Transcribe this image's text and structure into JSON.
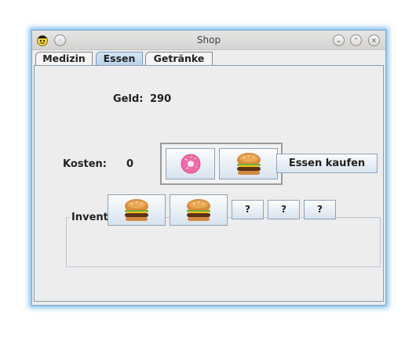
{
  "window": {
    "title": "Shop",
    "menu_label": "·",
    "minimize_label": "⌄",
    "maximize_label": "⌃",
    "close_label": "×"
  },
  "tabs": [
    {
      "label": "Medizin",
      "active": false
    },
    {
      "label": "Essen",
      "active": true
    },
    {
      "label": "Getränke",
      "active": false
    }
  ],
  "shop": {
    "money_label": "Geld:",
    "money_value": "290",
    "items": [
      {
        "icon": "donut-icon"
      },
      {
        "icon": "burger-icon"
      }
    ],
    "cost_label": "Kosten:",
    "cost_value": "0",
    "buy_button": "Essen kaufen"
  },
  "inventory": {
    "legend": "Inventar",
    "slots": [
      {
        "icon": "burger-icon",
        "label": ""
      },
      {
        "icon": "burger-icon",
        "label": ""
      },
      {
        "icon": "",
        "label": "?"
      },
      {
        "icon": "",
        "label": "?"
      },
      {
        "icon": "",
        "label": "?"
      }
    ]
  },
  "colors": {
    "accent_glow": "#5aaaeb",
    "active_tab": "#c8dcf0",
    "donut_pink": "#f06aa8"
  }
}
